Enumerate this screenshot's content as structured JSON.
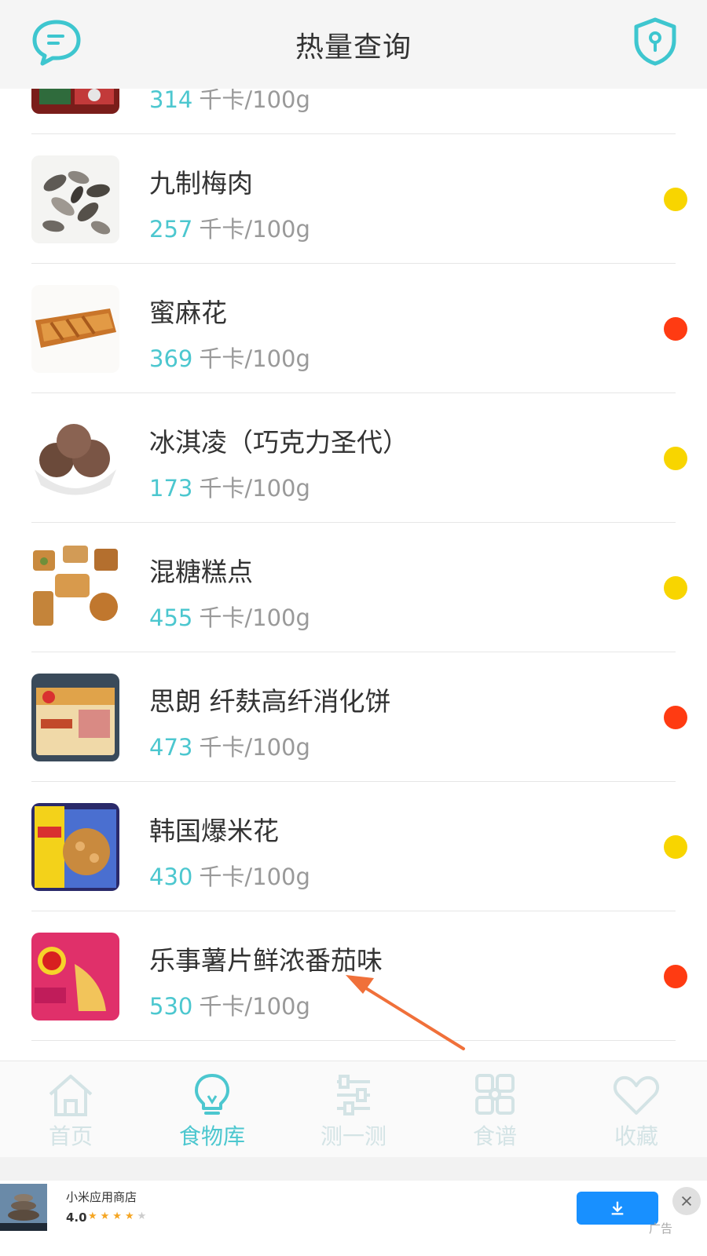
{
  "header": {
    "title": "热量查询",
    "left_icon": "chat-bubble-icon",
    "right_icon": "shield-lock-icon"
  },
  "list": {
    "unit": "千卡/100g",
    "items": [
      {
        "name": "",
        "calories": "314",
        "dot_color": "",
        "thumb": "red-packaged-food"
      },
      {
        "name": "九制梅肉",
        "calories": "257",
        "dot_color": "#f8d500",
        "thumb": "dried-plum"
      },
      {
        "name": "蜜麻花",
        "calories": "369",
        "dot_color": "#ff3b12",
        "thumb": "twisted-pastry"
      },
      {
        "name": "冰淇凌（巧克力圣代）",
        "calories": "173",
        "dot_color": "#f8d500",
        "thumb": "chocolate-ice-cream"
      },
      {
        "name": "混糖糕点",
        "calories": "455",
        "dot_color": "#f8d500",
        "thumb": "pastries"
      },
      {
        "name": "思朗 纤麸高纤消化饼",
        "calories": "473",
        "dot_color": "#ff3b12",
        "thumb": "cracker-pack"
      },
      {
        "name": "韩国爆米花",
        "calories": "430",
        "dot_color": "#f8d500",
        "thumb": "popcorn-pack"
      },
      {
        "name": "乐事薯片鲜浓番茄味",
        "calories": "530",
        "dot_color": "#ff3b12",
        "thumb": "chips-pack"
      }
    ]
  },
  "tabs": [
    {
      "label": "首页",
      "icon": "home-icon",
      "active": false
    },
    {
      "label": "食物库",
      "icon": "lightbulb-icon",
      "active": true
    },
    {
      "label": "测一测",
      "icon": "sliders-icon",
      "active": false
    },
    {
      "label": "食谱",
      "icon": "grid-icon",
      "active": false
    },
    {
      "label": "收藏",
      "icon": "heart-icon",
      "active": false
    }
  ],
  "ad": {
    "app_name": "小米应用商店",
    "rating": "4.0",
    "stars": "★★★★",
    "stars_off": "★",
    "mark": "广告"
  },
  "colors": {
    "accent": "#4cc7cf",
    "yellow_dot": "#f8d500",
    "red_dot": "#ff3b12",
    "arrow": "#f0703a"
  }
}
